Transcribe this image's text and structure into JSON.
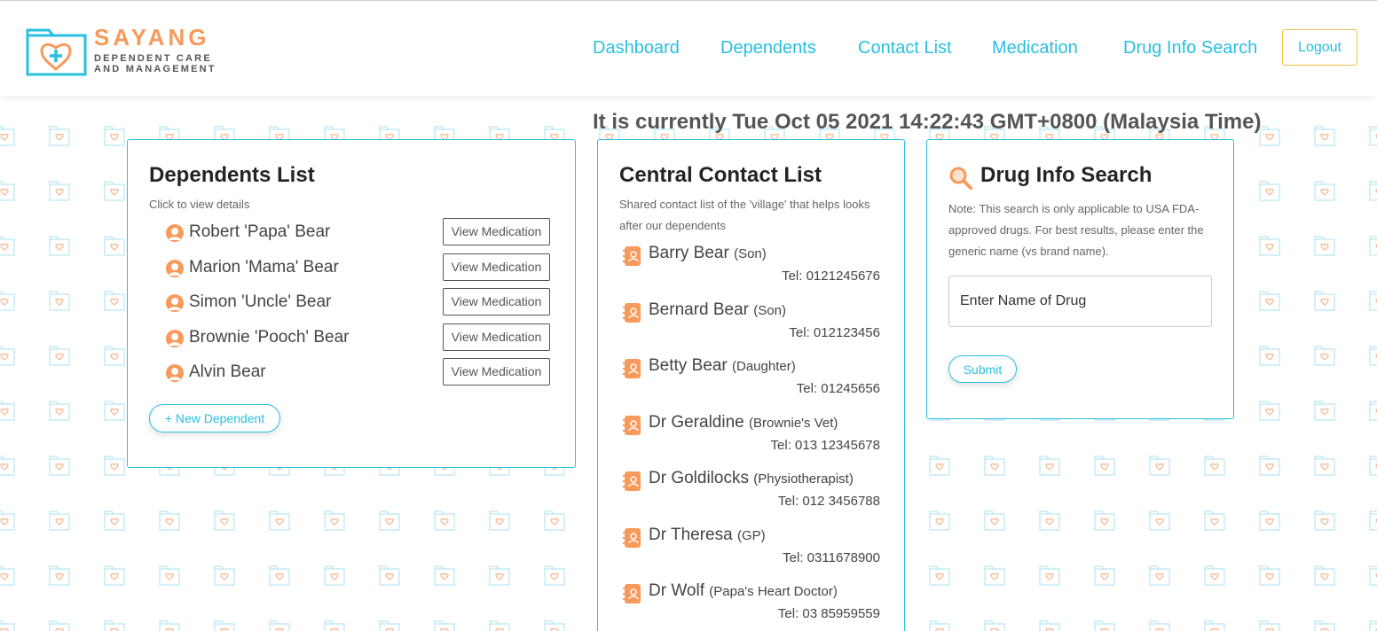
{
  "app": {
    "brand_name": "SAYANG",
    "brand_tagline_1": "DEPENDENT CARE",
    "brand_tagline_2": "AND MANAGEMENT",
    "accent_color": "#29bfe0",
    "brand_color": "#f79a5b"
  },
  "nav": {
    "items": [
      {
        "label": "Dashboard"
      },
      {
        "label": "Dependents"
      },
      {
        "label": "Contact List"
      },
      {
        "label": "Medication"
      },
      {
        "label": "Drug Info Search"
      }
    ],
    "logout_label": "Logout"
  },
  "clock": {
    "text": "It is currently Tue Oct 05 2021 14:22:43 GMT+0800 (Malaysia Time)"
  },
  "dependents": {
    "title": "Dependents List",
    "subtitle": "Click to view details",
    "view_button_label": "View Medication",
    "items": [
      {
        "name": "Robert 'Papa' Bear",
        "button": "View Medication"
      },
      {
        "name": "Marion 'Mama' Bear",
        "button": "View Medication"
      },
      {
        "name": "Simon 'Uncle' Bear",
        "button": "View Medication"
      },
      {
        "name": "Brownie 'Pooch' Bear",
        "button": "View Medication"
      },
      {
        "name": "Alvin Bear",
        "button": "View Medication"
      }
    ],
    "new_button_label": "+ New Dependent"
  },
  "contacts": {
    "title": "Central Contact List",
    "subtitle": "Shared contact list of the 'village' that helps looks after our dependents",
    "items": [
      {
        "name": "Barry Bear",
        "role": "(Son)",
        "tel": "Tel: 0121245676"
      },
      {
        "name": "Bernard Bear",
        "role": "(Son)",
        "tel": "Tel: 012123456"
      },
      {
        "name": "Betty Bear",
        "role": "(Daughter)",
        "tel": "Tel: 01245656"
      },
      {
        "name": "Dr Geraldine",
        "role": "(Brownie's Vet)",
        "tel": "Tel: 013 12345678"
      },
      {
        "name": "Dr Goldilocks",
        "role": "(Physiotherapist)",
        "tel": "Tel: 012 3456788"
      },
      {
        "name": "Dr Theresa",
        "role": "(GP)",
        "tel": "Tel: 0311678900"
      },
      {
        "name": "Dr Wolf",
        "role": "(Papa's Heart Doctor)",
        "tel": "Tel: 03 85959559"
      }
    ]
  },
  "drug_search": {
    "title": "Drug Info Search",
    "note": "Note: This search is only applicable to USA FDA-approved drugs. For best results, please enter the generic name (vs brand name).",
    "placeholder": "Enter Name of Drug",
    "value": "",
    "submit_label": "Submit"
  }
}
